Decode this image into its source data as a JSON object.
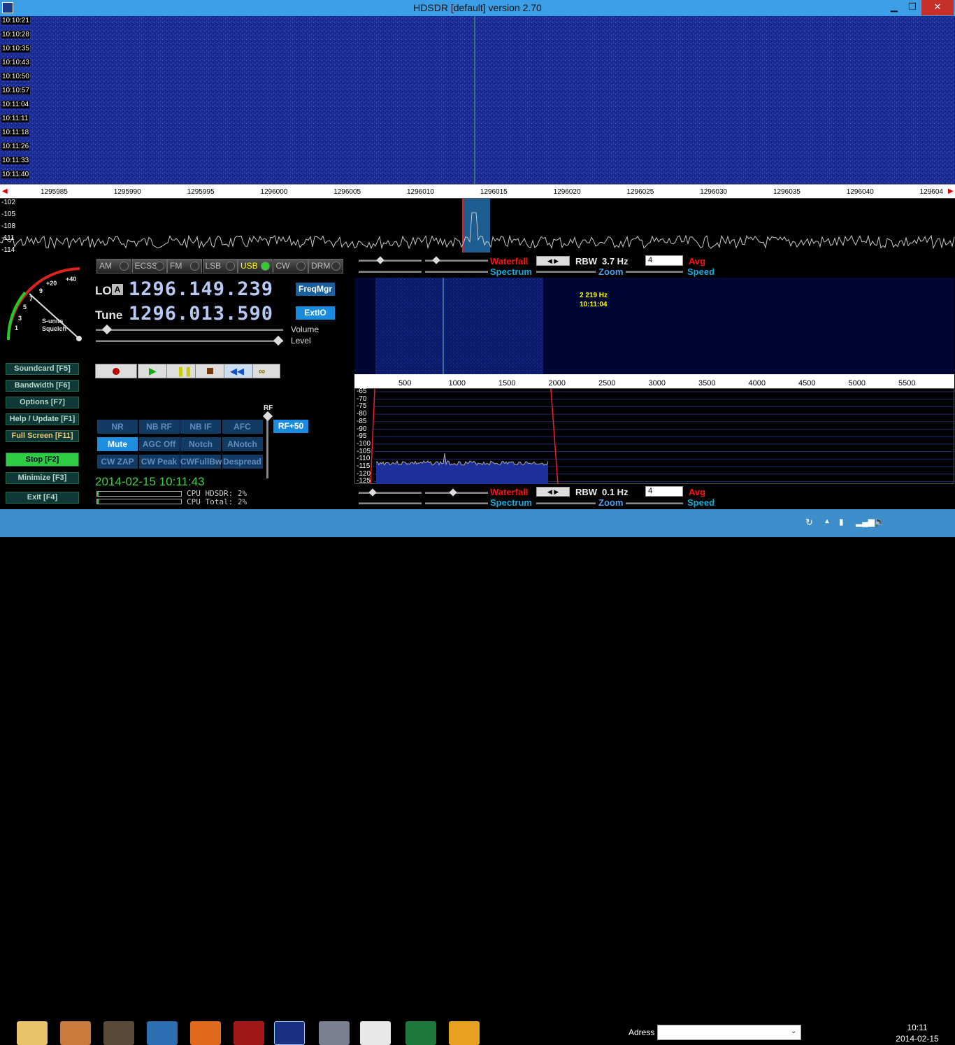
{
  "window": {
    "title": "HDSDR [default]  version 2.70",
    "minimize": "▁",
    "maximize": "❐",
    "close": "✕"
  },
  "waterfall": {
    "times": [
      "10:10:21",
      "10:10:28",
      "10:10:35",
      "10:10:43",
      "10:10:50",
      "10:10:57",
      "10:11:04",
      "10:11:11",
      "10:11:18",
      "10:11:26",
      "10:11:33",
      "10:11:40"
    ]
  },
  "freq_axis": [
    "1295985",
    "1295990",
    "1295995",
    "1296000",
    "1296005",
    "1296010",
    "1296015",
    "1296020",
    "1296025",
    "1296030",
    "1296035",
    "1296040",
    "129604"
  ],
  "spectrum": {
    "db_labels": [
      "-102",
      "-105",
      "-108",
      "-111",
      "-114"
    ]
  },
  "modes": [
    {
      "label": "AM",
      "active": false
    },
    {
      "label": "ECSS",
      "active": false
    },
    {
      "label": "FM",
      "active": false
    },
    {
      "label": "LSB",
      "active": false
    },
    {
      "label": "USB",
      "active": true
    },
    {
      "label": "CW",
      "active": false
    },
    {
      "label": "DRM",
      "active": false
    }
  ],
  "smeter": {
    "labels": [
      "+40",
      "+20",
      "9",
      "7",
      "5",
      "3",
      "1"
    ],
    "caption1": "S-units",
    "caption2": "Squelch"
  },
  "lo": {
    "label": "LO",
    "badge": "A",
    "freq": "1296.149.239"
  },
  "tune": {
    "label": "Tune",
    "freq": "1296.013.590"
  },
  "buttons": {
    "freqmgr": "FreqMgr",
    "extio": "ExtIO",
    "rf": "RF+50"
  },
  "sliders": {
    "volume": "Volume",
    "level": "Level",
    "rf": "RF"
  },
  "side_buttons": [
    "Soundcard  [F5]",
    "Bandwidth  [F6]",
    "Options  [F7]",
    "Help / Update  [F1]",
    "Full Screen  [F11]",
    "Stop  [F2]",
    "Minimize  [F3]",
    "Exit  [F4]"
  ],
  "dsp": [
    {
      "label": "NR",
      "on": false
    },
    {
      "label": "NB RF",
      "on": false
    },
    {
      "label": "NB IF",
      "on": false
    },
    {
      "label": "AFC",
      "on": false
    },
    {
      "label": "Mute",
      "on": true
    },
    {
      "label": "AGC Off",
      "on": false
    },
    {
      "label": "Notch",
      "on": false
    },
    {
      "label": "ANotch",
      "on": false
    },
    {
      "label": "CW ZAP",
      "on": false
    },
    {
      "label": "CW Peak",
      "on": false
    },
    {
      "label": "CWFullBw",
      "on": false
    },
    {
      "label": "Despread",
      "on": false
    }
  ],
  "status": {
    "datetime": "2014-02-15 10:11:43",
    "cpu_hdsdr": "CPU HDSDR: 2%",
    "cpu_total": "CPU Total: 2%",
    "cpu_hdsdr_level": 0.02,
    "cpu_total_level": 0.02
  },
  "ctl_top": {
    "waterfall": "Waterfall",
    "spectrum": "Spectrum",
    "rbw_label": "RBW",
    "rbw": "3.7 Hz",
    "zoom": "Zoom",
    "avg_value": "4",
    "avg": "Avg",
    "speed": "Speed"
  },
  "ctl_bottom": {
    "waterfall": "Waterfall",
    "spectrum": "Spectrum",
    "rbw_label": "RBW",
    "rbw": "0.1 Hz",
    "zoom": "Zoom",
    "avg_value": "4",
    "avg": "Avg",
    "speed": "Speed"
  },
  "audio": {
    "readout_freq": "2 219 Hz",
    "readout_time": "10:11:04",
    "axis": [
      "500",
      "1000",
      "1500",
      "2000",
      "2500",
      "3000",
      "3500",
      "4000",
      "4500",
      "5000",
      "5500"
    ],
    "db_labels": [
      "-65",
      "-70",
      "-75",
      "-80",
      "-85",
      "-90",
      "-95",
      "-100",
      "-105",
      "-110",
      "-115",
      "-120",
      "-125"
    ]
  },
  "taskbar": {
    "address_label": "Adress",
    "time": "10:11",
    "date": "2014-02-15"
  },
  "colors": {
    "waterfall_bg": "#1e2e9a",
    "accent_blue": "#1a8ce0",
    "stop_green": "#2ecc40",
    "taskbar": "#3d8ecb"
  }
}
